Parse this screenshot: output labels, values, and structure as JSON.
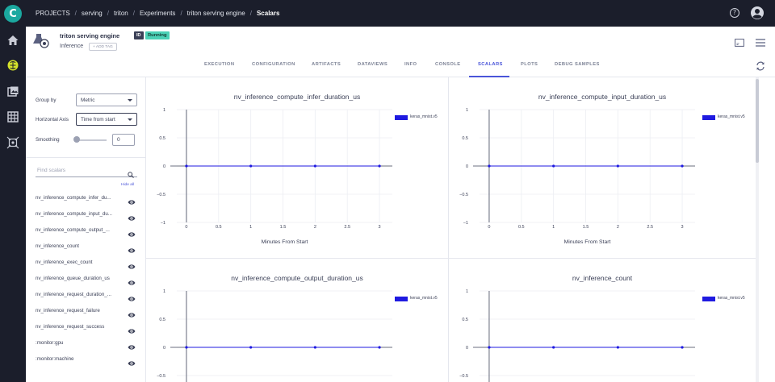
{
  "app": {
    "logo_letter": "C"
  },
  "breadcrumb": [
    "PROJECTS",
    "serving",
    "triton",
    "Experiments",
    "triton serving engine",
    "Scalars"
  ],
  "topbar": {
    "help_glyph": "?"
  },
  "task": {
    "name": "triton serving engine",
    "id_label": "ID",
    "status": "Running",
    "type": "Inference",
    "add_tag": "+ ADD TAG"
  },
  "tabs": [
    "EXECUTION",
    "CONFIGURATION",
    "ARTIFACTS",
    "DATAVIEWS",
    "INFO",
    "CONSOLE",
    "SCALARS",
    "PLOTS",
    "DEBUG SAMPLES"
  ],
  "active_tab": "SCALARS",
  "controls": {
    "group_by_label": "Group by",
    "group_by_value": "Metric",
    "horizontal_axis_label": "Horizontal Axis",
    "horizontal_axis_value": "Time from start",
    "smoothing_label": "Smoothing",
    "smoothing_value": "0",
    "smoothing_level": 0,
    "find_placeholder": "Find scalars",
    "hide_all": "Hide all"
  },
  "metrics": [
    "nv_inference_compute_infer_du...",
    "nv_inference_compute_input_du...",
    "nv_inference_compute_output_...",
    "nv_inference_count",
    "nv_inference_exec_count",
    "nv_inference_queue_duration_us",
    "nv_inference_request_duration_...",
    "nv_inference_request_failure",
    "nv_inference_request_success",
    ":monitor:gpu",
    ":monitor:machine"
  ],
  "colors": {
    "accent": "#4a55d9",
    "series": "#1f1ae0",
    "running": "#4bd1b6",
    "dark": "#1b1e2b"
  },
  "chart_data": [
    {
      "type": "line",
      "title": "nv_inference_compute_infer_duration_us",
      "xlabel": "Minutes From Start",
      "ylabel": "",
      "xlim": [
        -0.15,
        3.2
      ],
      "ylim": [
        -1,
        1
      ],
      "xticks": [
        0,
        0.5,
        1,
        1.5,
        2,
        2.5,
        3
      ],
      "xtick_labels": [
        "0",
        "0.5",
        "1",
        "1.5",
        "2",
        "2.5",
        "3"
      ],
      "yticks": [
        1,
        0.5,
        0,
        -0.5,
        -1
      ],
      "ytick_labels": [
        "1",
        "0.5",
        "0",
        "−0.5",
        "−1"
      ],
      "legend": "top-right",
      "series": [
        {
          "name": "keras_mnist.v5",
          "x": [
            0,
            1,
            2,
            3
          ],
          "values": [
            0,
            0,
            0,
            0
          ]
        }
      ]
    },
    {
      "type": "line",
      "title": "nv_inference_compute_input_duration_us",
      "xlabel": "Minutes From Start",
      "ylabel": "",
      "xlim": [
        -0.15,
        3.2
      ],
      "ylim": [
        -1,
        1
      ],
      "xticks": [
        0,
        0.5,
        1,
        1.5,
        2,
        2.5,
        3
      ],
      "xtick_labels": [
        "0",
        "0.5",
        "1",
        "1.5",
        "2",
        "2.5",
        "3"
      ],
      "yticks": [
        1,
        0.5,
        0,
        -0.5,
        -1
      ],
      "ytick_labels": [
        "1",
        "0.5",
        "0",
        "−0.5",
        "−1"
      ],
      "legend": "top-right",
      "series": [
        {
          "name": "keras_mnist.v5",
          "x": [
            0,
            1,
            2,
            3
          ],
          "values": [
            0,
            0,
            0,
            0
          ]
        }
      ]
    },
    {
      "type": "line",
      "title": "nv_inference_compute_output_duration_us",
      "xlabel": "",
      "ylabel": "",
      "xlim": [
        -0.15,
        3.2
      ],
      "ylim": [
        -1,
        1
      ],
      "xticks": [],
      "xtick_labels": [],
      "yticks": [
        1,
        0.5,
        0,
        -0.5
      ],
      "ytick_labels": [
        "1",
        "0.5",
        "0",
        "−0.5"
      ],
      "legend": "top-right",
      "series": [
        {
          "name": "keras_mnist.v5",
          "x": [
            0,
            1,
            2,
            3
          ],
          "values": [
            0,
            0,
            0,
            0
          ]
        }
      ]
    },
    {
      "type": "line",
      "title": "nv_inference_count",
      "xlabel": "",
      "ylabel": "",
      "xlim": [
        -0.15,
        3.2
      ],
      "ylim": [
        -1,
        1
      ],
      "xticks": [],
      "xtick_labels": [],
      "yticks": [
        1,
        0.5,
        0,
        -0.5
      ],
      "ytick_labels": [
        "1",
        "0.5",
        "0",
        "−0.5"
      ],
      "legend": "top-right",
      "series": [
        {
          "name": "keras_mnist.v5",
          "x": [
            0,
            1,
            2,
            3
          ],
          "values": [
            0,
            0,
            0,
            0
          ]
        }
      ]
    }
  ]
}
